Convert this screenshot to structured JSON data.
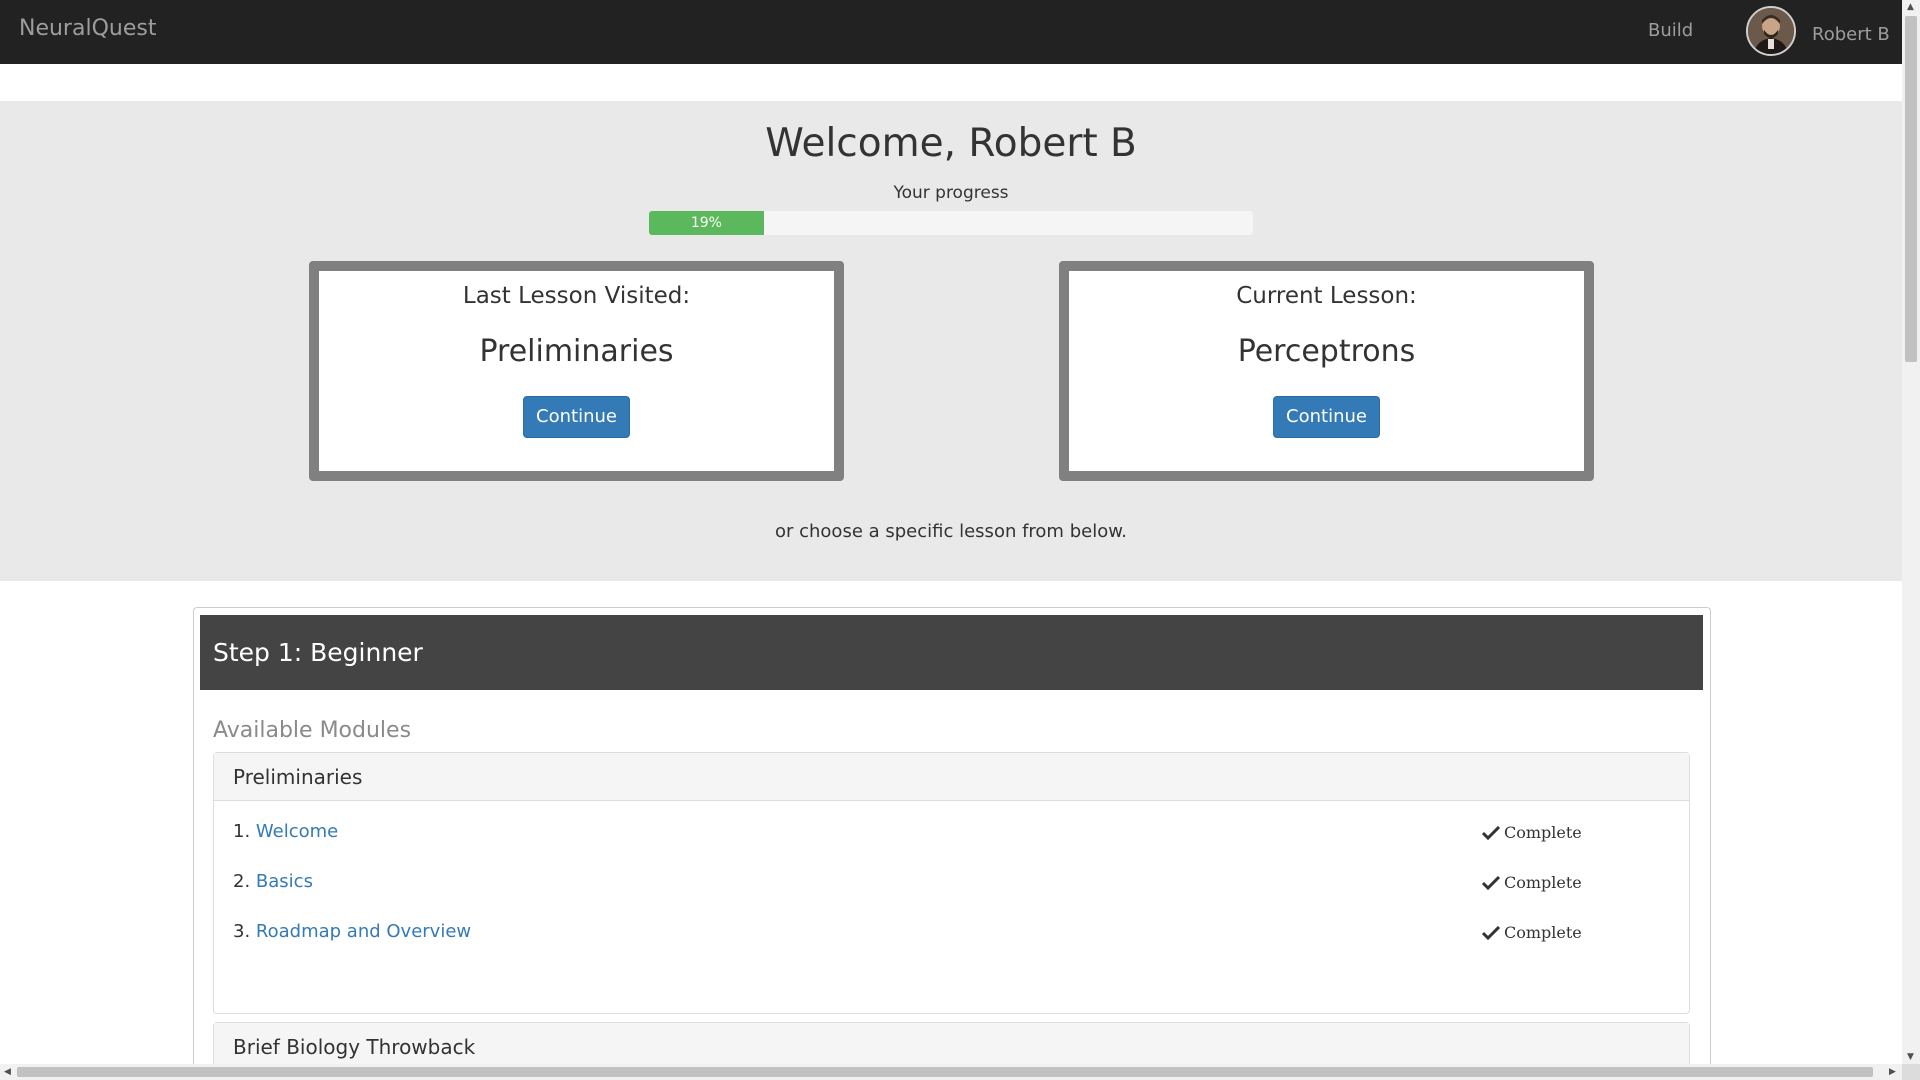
{
  "navbar": {
    "brand": "NeuralQuest",
    "build_label": "Build",
    "user_name": "Robert B"
  },
  "hero": {
    "welcome": "Welcome, Robert B",
    "progress_label": "Your progress",
    "progress_percent": 19,
    "progress_text": "19%",
    "choose_text": "or choose a specific lesson from below."
  },
  "cards": {
    "last": {
      "caption": "Last Lesson Visited:",
      "title": "Preliminaries",
      "button": "Continue"
    },
    "current": {
      "caption": "Current Lesson:",
      "title": "Perceptrons",
      "button": "Continue"
    }
  },
  "step": {
    "title": "Step 1: Beginner",
    "available_label": "Available Modules",
    "modules": [
      {
        "name": "Preliminaries",
        "lessons": [
          {
            "num": "1.",
            "title": "Welcome",
            "status": "Complete"
          },
          {
            "num": "2.",
            "title": "Basics",
            "status": "Complete"
          },
          {
            "num": "3.",
            "title": "Roadmap and Overview",
            "status": "Complete"
          }
        ]
      },
      {
        "name": "Brief Biology Throwback"
      }
    ]
  },
  "colors": {
    "navbar_bg": "#222222",
    "hero_bg": "#e9e9e9",
    "progress_fill": "#5cb85c",
    "primary_button": "#337ab7",
    "step_header_bg": "#444444",
    "link": "#337ab7"
  },
  "icons": {
    "status": "checkmark-icon",
    "avatar": "user-avatar"
  }
}
